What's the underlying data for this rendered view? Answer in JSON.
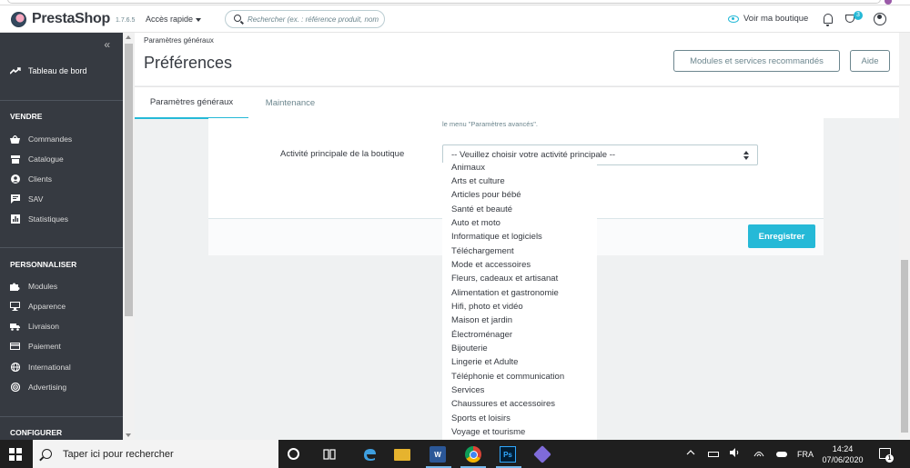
{
  "header": {
    "logo_text": "PrestaShop",
    "version": "1.7.6.5",
    "quick_access": "Accès rapide",
    "search_placeholder": "Rechercher (ex. : référence produit, nom",
    "view_shop": "Voir ma boutique",
    "trophy_badge": "3"
  },
  "sidebar": {
    "collapse": "«",
    "dashboard": "Tableau de bord",
    "sections": [
      {
        "title": "VENDRE",
        "items": [
          "Commandes",
          "Catalogue",
          "Clients",
          "SAV",
          "Statistiques"
        ]
      },
      {
        "title": "PERSONNALISER",
        "items": [
          "Modules",
          "Apparence",
          "Livraison",
          "Paiement",
          "International",
          "Advertising"
        ]
      },
      {
        "title": "CONFIGURER"
      }
    ]
  },
  "page": {
    "breadcrumb": "Paramètres généraux",
    "title": "Préférences",
    "modules_button": "Modules et services recommandés",
    "help_button": "Aide"
  },
  "tabs": [
    "Paramètres généraux",
    "Maintenance"
  ],
  "form": {
    "hint": "le menu \"Paramètres avancés\".",
    "activity_label": "Activité principale de la boutique",
    "activity_selected": "-- Veuillez choisir votre activité principale --",
    "save_button": "Enregistrer"
  },
  "dropdown_options": [
    "Animaux",
    "Arts et culture",
    "Articles pour bébé",
    "Santé et beauté",
    "Auto et moto",
    "Informatique et logiciels",
    "Téléchargement",
    "Mode et accessoires",
    "Fleurs, cadeaux et artisanat",
    "Alimentation et gastronomie",
    "Hifi, photo et vidéo",
    "Maison et jardin",
    "Électroménager",
    "Bijouterie",
    "Lingerie et Adulte",
    "Téléphonie et communication",
    "Services",
    "Chaussures et accessoires",
    "Sports et loisirs",
    "Voyage et tourisme"
  ],
  "taskbar": {
    "search_text": "Taper ici pour rechercher",
    "word_label": "W",
    "ps_label": "Ps",
    "language": "FRA",
    "time": "14:24",
    "date": "07/06/2020",
    "notification_count": "1"
  },
  "colors": {
    "accent": "#25b9d7",
    "sidebar_bg": "#363a41",
    "page_bg": "#eff1f2"
  }
}
